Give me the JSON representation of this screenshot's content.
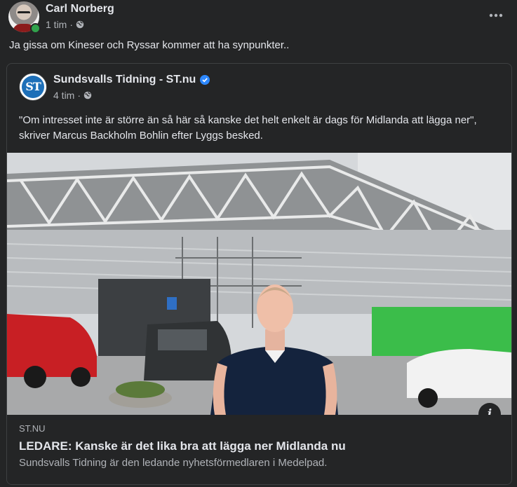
{
  "post": {
    "author": "Carl Norberg",
    "time": "1 tim",
    "separator": "·",
    "text": "Ja gissa om Kineser och Ryssar kommer att ha synpunkter..",
    "more_icon": "more-horizontal-icon"
  },
  "shared": {
    "page_name": "Sundsvalls Tidning - ST.nu",
    "page_logo_text": "ST",
    "time": "4 tim",
    "separator": "·",
    "text": "\"Om intresset inte är större än så här så kanske det helt enkelt är dags för Midlanda att lägga ner\", skriver Marcus Backholm Bohlin efter Lyggs besked."
  },
  "link": {
    "domain": "ST.NU",
    "title": "LEDARE: Kanske är det lika bra att lägga ner Midlanda nu",
    "description": "Sundsvalls Tidning är den ledande nyhetsförmedlaren i Medelpad.",
    "info_label": "i"
  },
  "colors": {
    "background": "#242526",
    "text_primary": "#e4e6eb",
    "text_secondary": "#b0b3b8",
    "online": "#31a24c",
    "verified": "#2d88ff"
  }
}
